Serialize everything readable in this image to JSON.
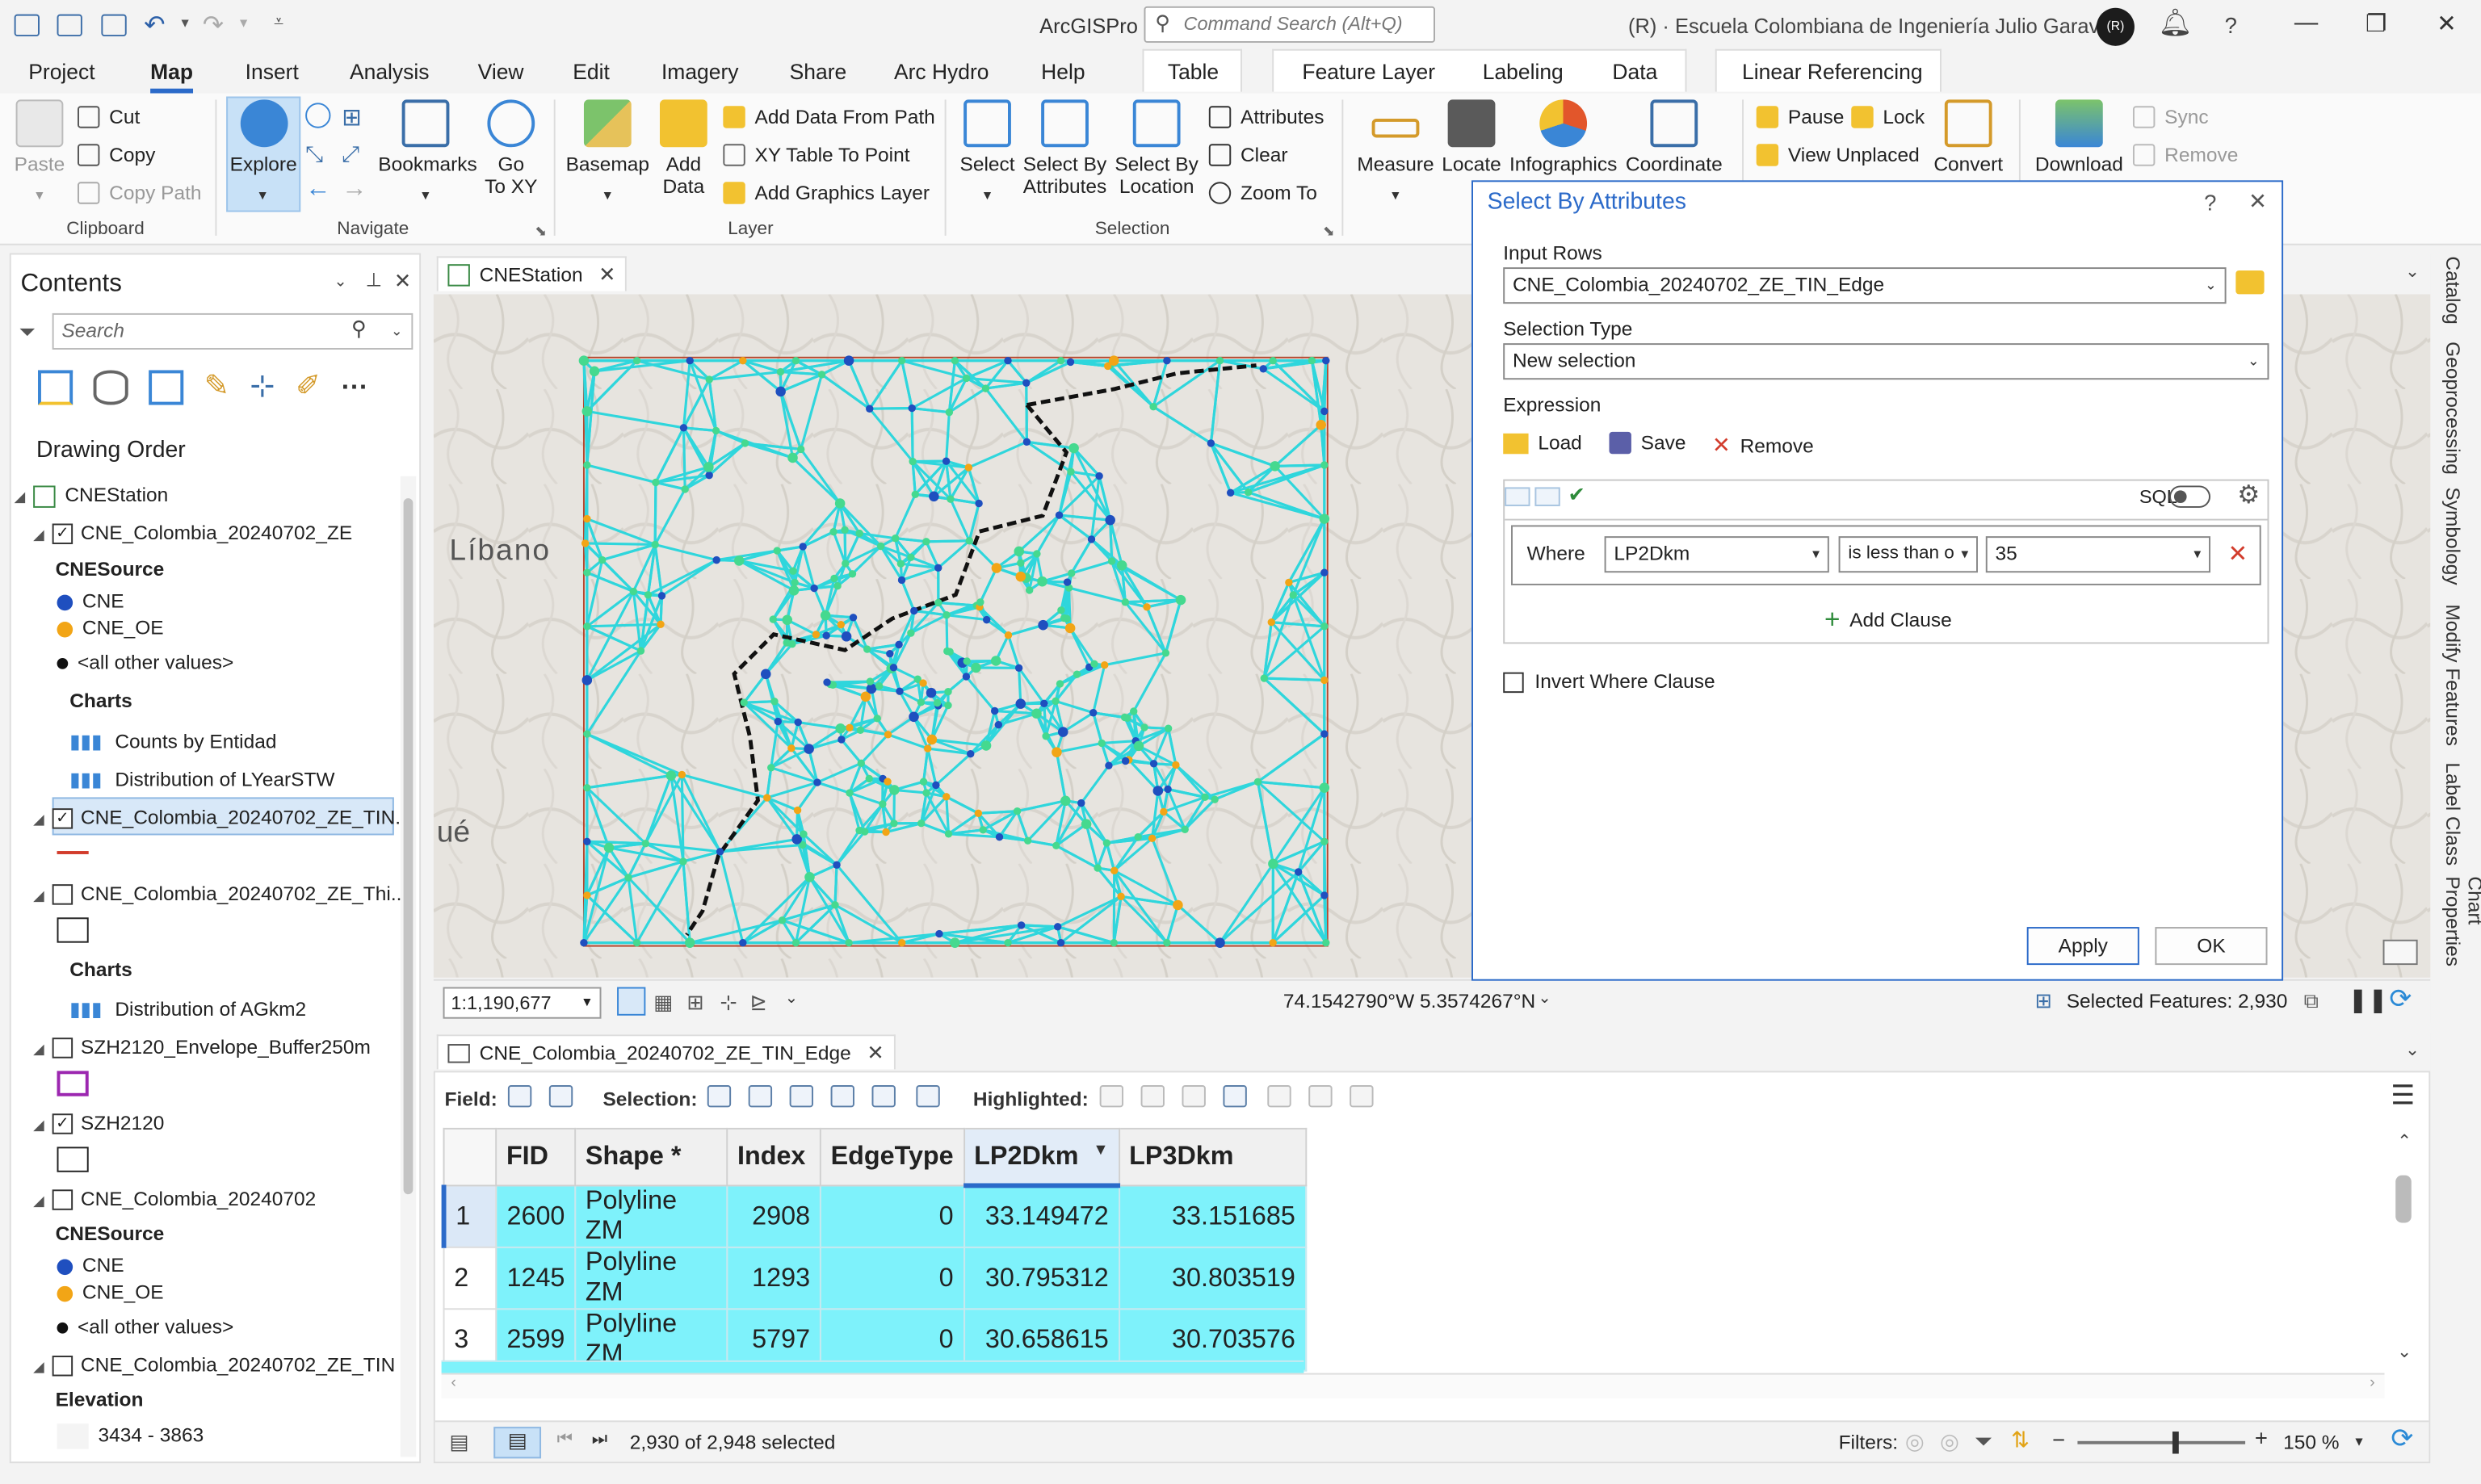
{
  "app": {
    "name": "ArcGISPro",
    "command_search_placeholder": "Command Search (Alt+Q)",
    "org": "(R)  ·  Escuela Colombiana de Ingeniería Julio Garavito",
    "avatar_initials": "(R)"
  },
  "ribbon_tabs": [
    "Project",
    "Map",
    "Insert",
    "Analysis",
    "View",
    "Edit",
    "Imagery",
    "Share",
    "Arc Hydro",
    "Help"
  ],
  "active_tab": "Map",
  "context_tabs": [
    "Table",
    "Feature Layer",
    "Labeling",
    "Data",
    "Linear Referencing"
  ],
  "ribbon": {
    "clipboard": {
      "label": "Clipboard",
      "paste": "Paste",
      "cut": "Cut",
      "copy": "Copy",
      "copy_path": "Copy Path"
    },
    "navigate": {
      "label": "Navigate",
      "explore": "Explore",
      "bookmarks": "Bookmarks",
      "go_to_xy_1": "Go",
      "go_to_xy_2": "To XY"
    },
    "layer": {
      "label": "Layer",
      "basemap": "Basemap",
      "add_data_1": "Add",
      "add_data_2": "Data",
      "add_data_from_path": "Add Data From Path",
      "xy_table_to_point": "XY Table To Point",
      "add_graphics_layer": "Add Graphics Layer"
    },
    "selection": {
      "label": "Selection",
      "select": "Select",
      "select_by_attributes_1": "Select By",
      "select_by_attributes_2": "Attributes",
      "select_by_location_1": "Select By",
      "select_by_location_2": "Location",
      "attributes": "Attributes",
      "clear": "Clear",
      "zoom_to": "Zoom To"
    },
    "inquiry": {
      "measure": "Measure",
      "locate": "Locate",
      "infographics": "Infographics",
      "coordinate": "Coordinate"
    },
    "labeling": {
      "pause": "Pause",
      "lock": "Lock",
      "view_unplaced": "View Unplaced",
      "convert": "Convert"
    },
    "offline": {
      "download": "Download",
      "sync": "Sync",
      "remove": "Remove"
    }
  },
  "contents": {
    "title": "Contents",
    "search_placeholder": "Search",
    "drawing_order": "Drawing Order",
    "map_name": "CNEStation",
    "layers": [
      {
        "name": "CNE_Colombia_20240702_ZE",
        "checked": true
      },
      {
        "name": "CNE_Colombia_20240702_ZE_TIN...",
        "checked": true
      },
      {
        "name": "CNE_Colombia_20240702_ZE_Thi...",
        "checked": false
      },
      {
        "name": "SZH2120_Envelope_Buffer250m",
        "checked": false
      },
      {
        "name": "SZH2120",
        "checked": true
      },
      {
        "name": "CNE_Colombia_20240702",
        "checked": false
      },
      {
        "name": "CNE_Colombia_20240702_ZE_TIN",
        "checked": false
      }
    ],
    "labels": {
      "cnesource_1": "CNESource",
      "cne": "CNE",
      "cne_oe": "CNE_OE",
      "all_other": "<all other values>",
      "charts_1": "Charts",
      "counts_by_entidad": "Counts by Entidad",
      "distribution_lyear": "Distribution of LYearSTW",
      "charts_2": "Charts",
      "distribution_agkm2": "Distribution of AGkm2",
      "cnesource_2": "CNESource",
      "elevation": "Elevation",
      "elevation_range": "3434 - 3863"
    },
    "colors": {
      "cne": "#1f4fbf",
      "cne_oe": "#f2a516",
      "tin_edge": "#d23c2c",
      "buffer": "#9c27b0"
    }
  },
  "map_view": {
    "tab_title": "CNEStation",
    "scale": "1:1,190,677",
    "coords": "74.1542790°W 5.3574267°N",
    "selected_features": "Selected Features: 2,930",
    "place_labels": [
      "Líbano",
      "ué"
    ]
  },
  "dialog": {
    "title": "Select By Attributes",
    "input_rows_label": "Input Rows",
    "input_rows_value": "CNE_Colombia_20240702_ZE_TIN_Edge",
    "selection_type_label": "Selection Type",
    "selection_type_value": "New selection",
    "expression_label": "Expression",
    "load": "Load",
    "save": "Save",
    "remove": "Remove",
    "sql": "SQL",
    "where": "Where",
    "field": "LP2Dkm",
    "operator": "is less than o",
    "value": "35",
    "add_clause": "Add Clause",
    "invert": "Invert Where Clause",
    "apply": "Apply",
    "ok": "OK"
  },
  "table": {
    "tab_title": "CNE_Colombia_20240702_ZE_TIN_Edge",
    "field_label": "Field:",
    "selection_label": "Selection:",
    "highlighted_label": "Highlighted:",
    "columns": [
      "FID",
      "Shape *",
      "Index",
      "EdgeType",
      "LP2Dkm",
      "LP3Dkm"
    ],
    "rows": [
      [
        "1",
        "2600",
        "Polyline ZM",
        "2908",
        "0",
        "33.149472",
        "33.151685"
      ],
      [
        "2",
        "1245",
        "Polyline ZM",
        "1293",
        "0",
        "30.795312",
        "30.803519"
      ],
      [
        "3",
        "2599",
        "Polyline ZM",
        "5797",
        "0",
        "30.658615",
        "30.703576"
      ]
    ],
    "selected_status": "2,930 of 2,948 selected",
    "filters_label": "Filters:",
    "zoom": "150 %"
  },
  "right_rail": [
    "Catalog",
    "Geoprocessing",
    "Symbology",
    "Modify Features",
    "Label Class",
    "Chart Properties"
  ]
}
